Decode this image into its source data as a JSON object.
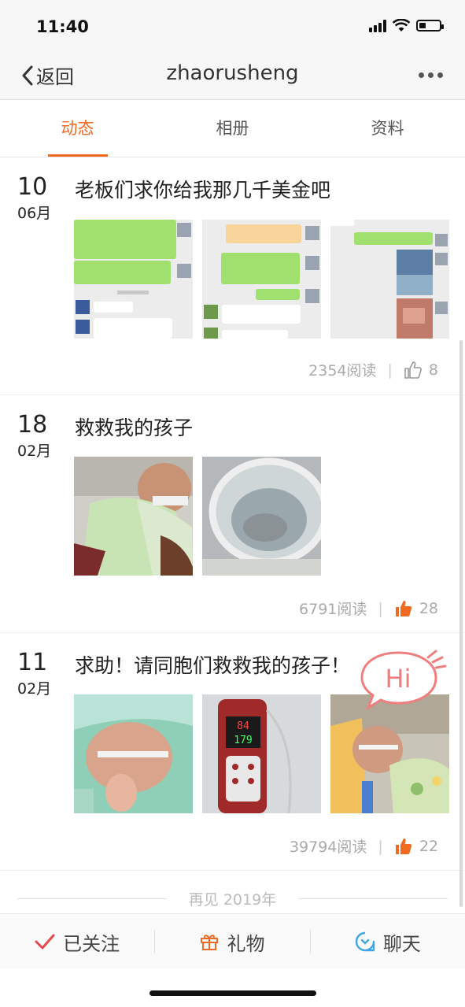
{
  "status_bar": {
    "time": "11:40"
  },
  "nav": {
    "back_label": "返回",
    "title": "zhaorusheng"
  },
  "tabs": [
    {
      "label": "动态"
    },
    {
      "label": "相册"
    },
    {
      "label": "资料"
    }
  ],
  "posts": [
    {
      "day": "10",
      "month": "06月",
      "title": "老板们求你给我那几千美金吧",
      "reads": "2354阅读",
      "likes": "8"
    },
    {
      "day": "18",
      "month": "02月",
      "title": "救救我的孩子",
      "reads": "6791阅读",
      "likes": "28"
    },
    {
      "day": "11",
      "month": "02月",
      "title": "求助！请同胞们救救我的孩子！",
      "reads": "39794阅读",
      "likes": "22"
    }
  ],
  "hi_badge": "Hi",
  "farewell": "再见 2019年",
  "bottom_bar": {
    "follow_label": "已关注",
    "gift_label": "礼物",
    "chat_label": "聊天"
  },
  "colors": {
    "accent": "#f06a23",
    "follow_check": "#e5484d",
    "chat_icon": "#3ea6e8"
  }
}
